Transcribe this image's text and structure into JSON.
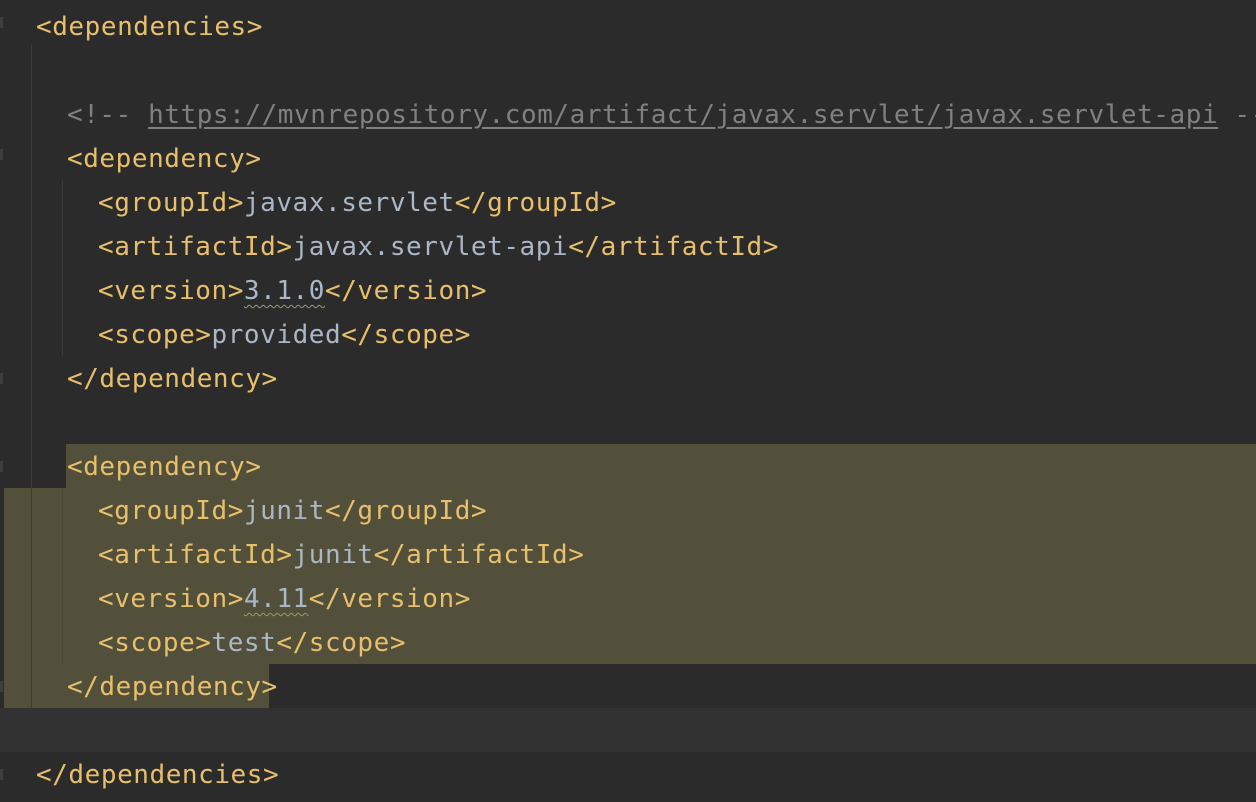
{
  "editor": {
    "lines": {
      "deps_open": "<dependencies>",
      "comment_open": "<!-- ",
      "comment_url": "https://mvnrepository.com/artifact/javax.servlet/javax.servlet-api",
      "comment_close": " -->",
      "dep1_open": "<dependency>",
      "dep1_groupId_open": "<groupId>",
      "dep1_groupId_value": "javax.servlet",
      "dep1_groupId_close": "</groupId>",
      "dep1_artifactId_open": "<artifactId>",
      "dep1_artifactId_value": "javax.servlet-api",
      "dep1_artifactId_close": "</artifactId>",
      "dep1_version_open": "<version>",
      "dep1_version_value": "3.1.0",
      "dep1_version_close": "</version>",
      "dep1_scope_open": "<scope>",
      "dep1_scope_value": "provided",
      "dep1_scope_close": "</scope>",
      "dep1_close": "</dependency>",
      "dep2_open": "<dependency>",
      "dep2_groupId_open": "<groupId>",
      "dep2_groupId_value": "junit",
      "dep2_groupId_close": "</groupId>",
      "dep2_artifactId_open": "<artifactId>",
      "dep2_artifactId_value": "junit",
      "dep2_artifactId_close": "</artifactId>",
      "dep2_version_open": "<version>",
      "dep2_version_value": "4.11",
      "dep2_version_close": "</version>",
      "dep2_scope_open": "<scope>",
      "dep2_scope_value": "test",
      "dep2_scope_close": "</scope>",
      "dep2_close": "</dependency>",
      "deps_close": "</dependencies>"
    },
    "colors": {
      "background": "#2b2b2b",
      "tag": "#e8bf6a",
      "text": "#a9b7c6",
      "comment": "#808080",
      "selection_highlight": "#52503a"
    }
  }
}
